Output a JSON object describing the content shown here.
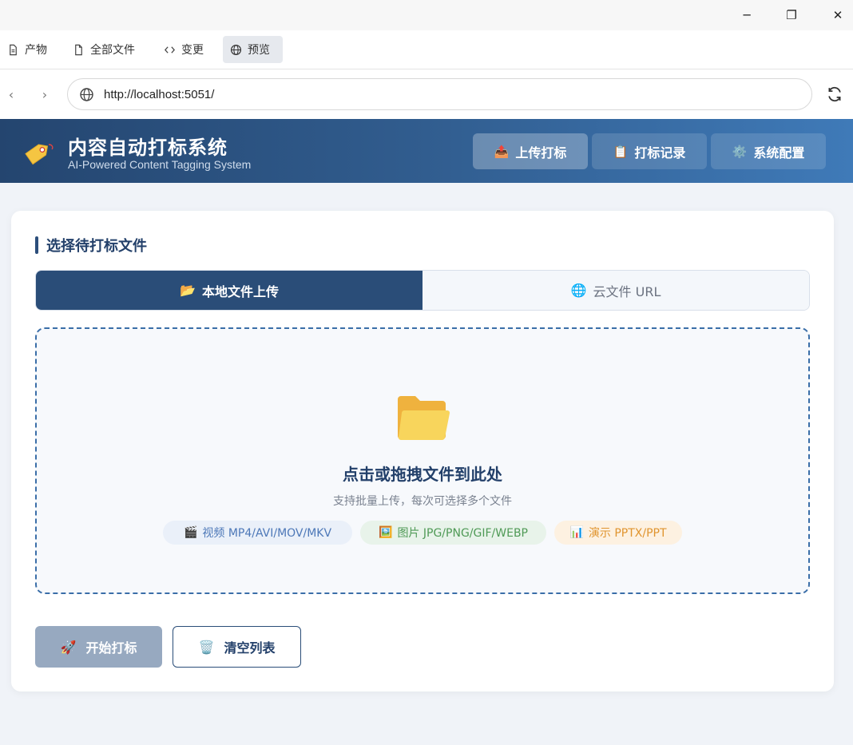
{
  "window": {
    "minimize": "─",
    "restore": "❐",
    "close": "✕"
  },
  "tabs": [
    {
      "label": "产物",
      "icon": "document-icon"
    },
    {
      "label": "全部文件",
      "icon": "file-icon"
    },
    {
      "label": "变更",
      "icon": "code-icon"
    },
    {
      "label": "预览",
      "icon": "globe-icon",
      "active": true
    }
  ],
  "browser": {
    "url": "http://localhost:5051/",
    "back": "‹",
    "forward": "›"
  },
  "header": {
    "title": "内容自动打标系统",
    "subtitle": "AI-Powered Content Tagging System",
    "nav": [
      {
        "label": "上传打标",
        "icon": "📤",
        "active": true
      },
      {
        "label": "打标记录",
        "icon": "📋"
      },
      {
        "label": "系统配置",
        "icon": "⚙️"
      }
    ]
  },
  "card": {
    "section_title": "选择待打标文件",
    "modes": [
      {
        "label": "本地文件上传",
        "icon": "📂",
        "active": true
      },
      {
        "label": "云文件 URL",
        "icon": "🌐"
      }
    ],
    "dropzone": {
      "title": "点击或拖拽文件到此处",
      "subtitle": "支持批量上传，每次可选择多个文件",
      "chips": {
        "video": {
          "icon": "🎬",
          "label": "视频 MP4/AVI/MOV/MKV"
        },
        "image": {
          "icon": "🖼️",
          "label": "图片 JPG/PNG/GIF/WEBP"
        },
        "pres": {
          "icon": "📊",
          "label": "演示 PPTX/PPT"
        }
      }
    },
    "buttons": {
      "start": {
        "icon": "🚀",
        "label": "开始打标"
      },
      "clear": {
        "icon": "🗑️",
        "label": "清空列表"
      }
    }
  },
  "colors": {
    "header_start": "#24456f",
    "header_end": "#3f7ab8",
    "accent": "#2a4d78"
  }
}
